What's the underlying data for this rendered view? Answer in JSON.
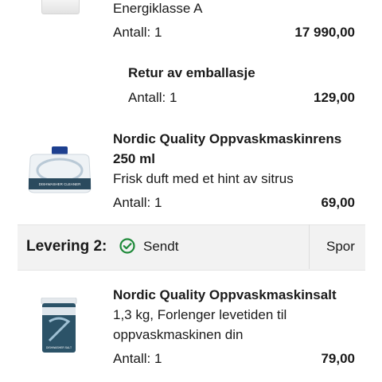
{
  "items": [
    {
      "description": "Energiklasse A",
      "quantity": "Antall: 1",
      "price": "17 990,00"
    },
    {
      "title": "Retur av emballasje",
      "quantity": "Antall: 1",
      "price": "129,00"
    },
    {
      "title_line1": "Nordic Quality Oppvaskmaskinrens",
      "title_line2": "250 ml",
      "description": "Frisk duft med et hint av sitrus",
      "quantity": "Antall: 1",
      "price": "69,00",
      "image_label": "DISHWASHER CLEANER"
    },
    {
      "title": "Nordic Quality Oppvaskmaskinsalt",
      "description_line1": "1,3 kg, Forlenger levetiden til",
      "description_line2": "oppvaskmaskinen din",
      "quantity": "Antall: 1",
      "price": "79,00",
      "image_label": "DISHWASHER SALT"
    }
  ],
  "delivery": {
    "label": "Levering 2:",
    "status": "Sendt",
    "track_label": "Spor",
    "status_color": "#1f8a3a"
  },
  "icons": {
    "status": "check-circle-icon"
  }
}
